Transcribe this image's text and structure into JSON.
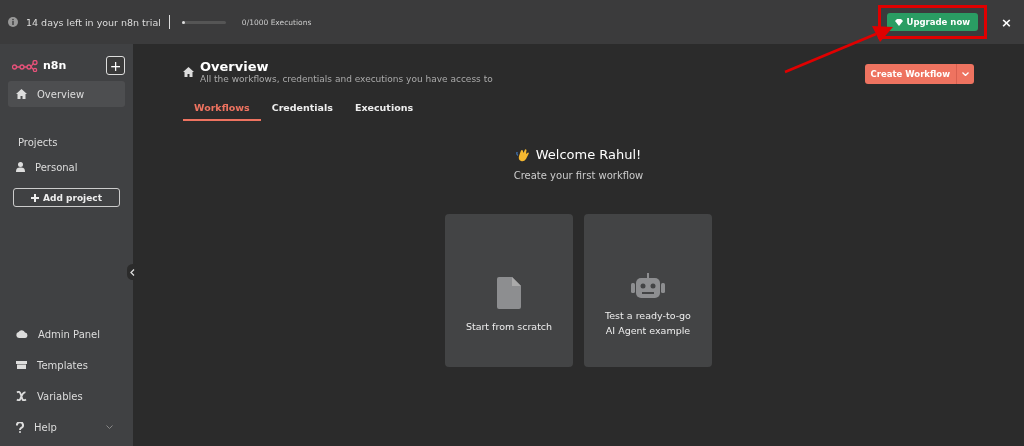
{
  "banner": {
    "trial_text": "14 days left in your n8n trial",
    "executions": {
      "level": 0,
      "reading": "0/1000 Executions"
    },
    "upgrade_button": "Upgrade now",
    "close": "×"
  },
  "sidebar": {
    "logo": "n8n",
    "new_button": "+",
    "top_items": [
      {
        "label": "Overview",
        "kind": "home",
        "selected": true
      }
    ],
    "projects_heading": "Projects",
    "projects": [
      {
        "label": "Personal",
        "kind": "user",
        "selected": false
      }
    ],
    "add_project": "Add project",
    "bottom_items": [
      {
        "label": "Admin Panel",
        "kind": "cloud",
        "expandable": false
      },
      {
        "label": "Templates",
        "kind": "box",
        "expandable": false
      },
      {
        "label": "Variables",
        "kind": "variable",
        "expandable": false
      },
      {
        "label": "Help",
        "kind": "help",
        "expandable": true
      }
    ]
  },
  "header": {
    "title": "Overview",
    "subtitle": "All the workflows, credentials and executions you have access to",
    "create_button": "Create Workflow"
  },
  "tabs": [
    {
      "label": "Workflows",
      "selected": true
    },
    {
      "label": "Credentials",
      "selected": false
    },
    {
      "label": "Executions",
      "selected": false
    }
  ],
  "welcome": {
    "title": "Welcome Rahul!",
    "subtitle": "Create your first workflow"
  },
  "cards": [
    {
      "kind": "file",
      "lines": [
        "Start from scratch"
      ]
    },
    {
      "kind": "robot",
      "lines": [
        "Test a ready-to-go",
        "AI Agent example"
      ]
    }
  ]
}
